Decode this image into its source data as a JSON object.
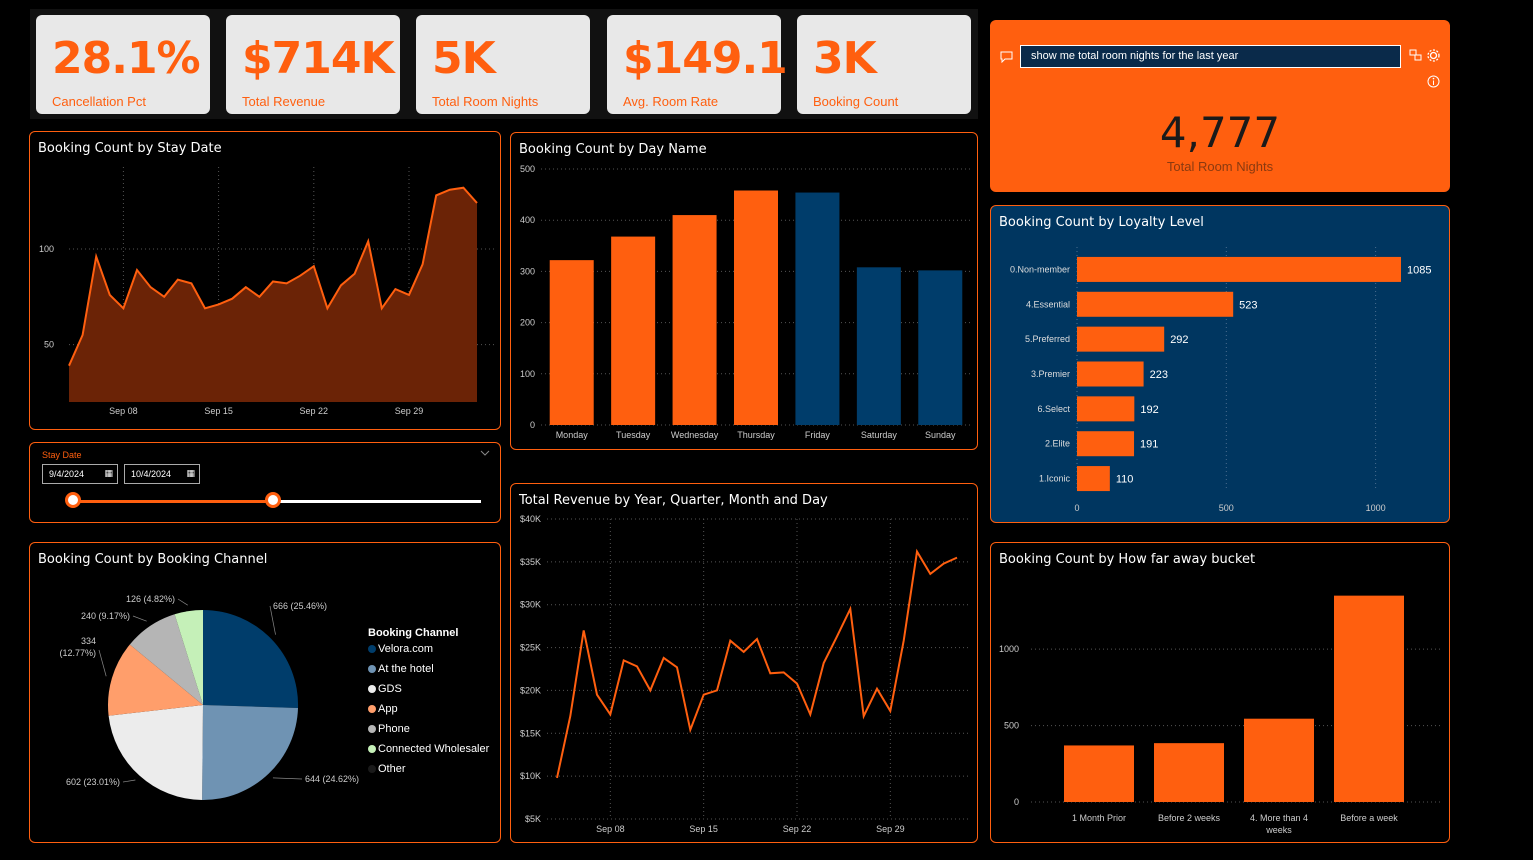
{
  "kpis": [
    {
      "value": "28.1%",
      "label": "Cancellation Pct"
    },
    {
      "value": "$714K",
      "label": "Total Revenue"
    },
    {
      "value": "5K",
      "label": "Total Room Nights"
    },
    {
      "value": "$149.1",
      "label": "Avg. Room Rate"
    },
    {
      "value": "3K",
      "label": "Booking Count"
    }
  ],
  "qa": {
    "query": "show me total room nights for the last year",
    "result_value": "4,777",
    "result_label": "Total Room Nights"
  },
  "slicer": {
    "title": "Stay Date",
    "start": "9/4/2024",
    "end": "10/4/2024"
  },
  "colors": {
    "accent": "#ff5f0f",
    "navy": "#003660",
    "area_fill": "#6b2306"
  },
  "chart_data": [
    {
      "id": "stay_date",
      "type": "area",
      "title": "Booking Count by Stay Date",
      "x_ticks": [
        "Sep 08",
        "Sep 15",
        "Sep 22",
        "Sep 29"
      ],
      "y_ticks": [
        50,
        100
      ],
      "ylim": [
        20,
        135
      ],
      "values": [
        39,
        55,
        96,
        76,
        69,
        89,
        80,
        75,
        84,
        82,
        69,
        71,
        74,
        80,
        75,
        83,
        82,
        86,
        91,
        69,
        81,
        87,
        104,
        69,
        79,
        76,
        92,
        128,
        131,
        132,
        124
      ]
    },
    {
      "id": "day_name",
      "type": "bar",
      "title": "Booking Count by Day Name",
      "categories": [
        "Monday",
        "Tuesday",
        "Wednesday",
        "Thursday",
        "Friday",
        "Saturday",
        "Sunday"
      ],
      "values": [
        322,
        368,
        410,
        458,
        454,
        308,
        302
      ],
      "bar_colors": [
        "#ff5f0f",
        "#ff5f0f",
        "#ff5f0f",
        "#ff5f0f",
        "#003d6b",
        "#003d6b",
        "#003d6b"
      ],
      "ylim": [
        0,
        500
      ],
      "y_ticks": [
        0,
        100,
        200,
        300,
        400,
        500
      ]
    },
    {
      "id": "loyalty",
      "type": "bar",
      "orientation": "horizontal",
      "title": "Booking Count by Loyalty Level",
      "categories": [
        "0.Non-member",
        "4.Essential",
        "5.Preferred",
        "3.Premier",
        "6.Select",
        "2.Elite",
        "1.Iconic"
      ],
      "values": [
        1085,
        523,
        292,
        223,
        192,
        191,
        110
      ],
      "xlim": [
        0,
        1085
      ],
      "x_ticks": [
        0,
        500,
        1000
      ]
    },
    {
      "id": "revenue",
      "type": "line",
      "title": "Total Revenue by Year, Quarter, Month and Day",
      "x_ticks": [
        "Sep 08",
        "Sep 15",
        "Sep 22",
        "Sep 29"
      ],
      "y_ticks": [
        "$5K",
        "$10K",
        "$15K",
        "$20K",
        "$25K",
        "$30K",
        "$35K",
        "$40K"
      ],
      "ylim": [
        5000,
        40000
      ],
      "values": [
        9800,
        17000,
        27000,
        19500,
        17200,
        23500,
        22800,
        20000,
        23800,
        22700,
        15400,
        19500,
        20000,
        25800,
        24500,
        26000,
        22000,
        22100,
        20800,
        17200,
        23200,
        26300,
        29500,
        17000,
        20200,
        17600,
        25800,
        36200,
        33600,
        34800,
        35500
      ]
    },
    {
      "id": "channel",
      "type": "pie",
      "title": "Booking Count by Booking Channel",
      "legend_title": "Booking Channel",
      "slices": [
        {
          "name": "Velora.com",
          "value": 666,
          "label": "666 (25.46%)",
          "color": "#003d6b"
        },
        {
          "name": "At the hotel",
          "value": 644,
          "label": "644 (24.62%)",
          "color": "#6f93b3"
        },
        {
          "name": "GDS",
          "value": 602,
          "label": "602 (23.01%)",
          "color": "#ececec"
        },
        {
          "name": "App",
          "value": 334,
          "label": "334 (12.77%)",
          "color": "#ff9e6b"
        },
        {
          "name": "Phone",
          "value": 240,
          "label": "240 (9.17%)",
          "color": "#b5b5b5"
        },
        {
          "name": "Connected Wholesaler",
          "value": 126,
          "label": "126 (4.82%)",
          "color": "#c5f0b8"
        },
        {
          "name": "Other",
          "value": 0,
          "label": "",
          "color": "#1a1a1a"
        }
      ]
    },
    {
      "id": "how_far",
      "type": "bar",
      "title": "Booking Count by How far away bucket",
      "categories": [
        "1 Month Prior",
        "Before 2 weeks",
        "4. More than 4 weeks",
        "Before a week"
      ],
      "values": [
        370,
        385,
        545,
        1350
      ],
      "ylim": [
        0,
        1400
      ],
      "y_ticks": [
        0,
        500,
        1000
      ]
    }
  ]
}
